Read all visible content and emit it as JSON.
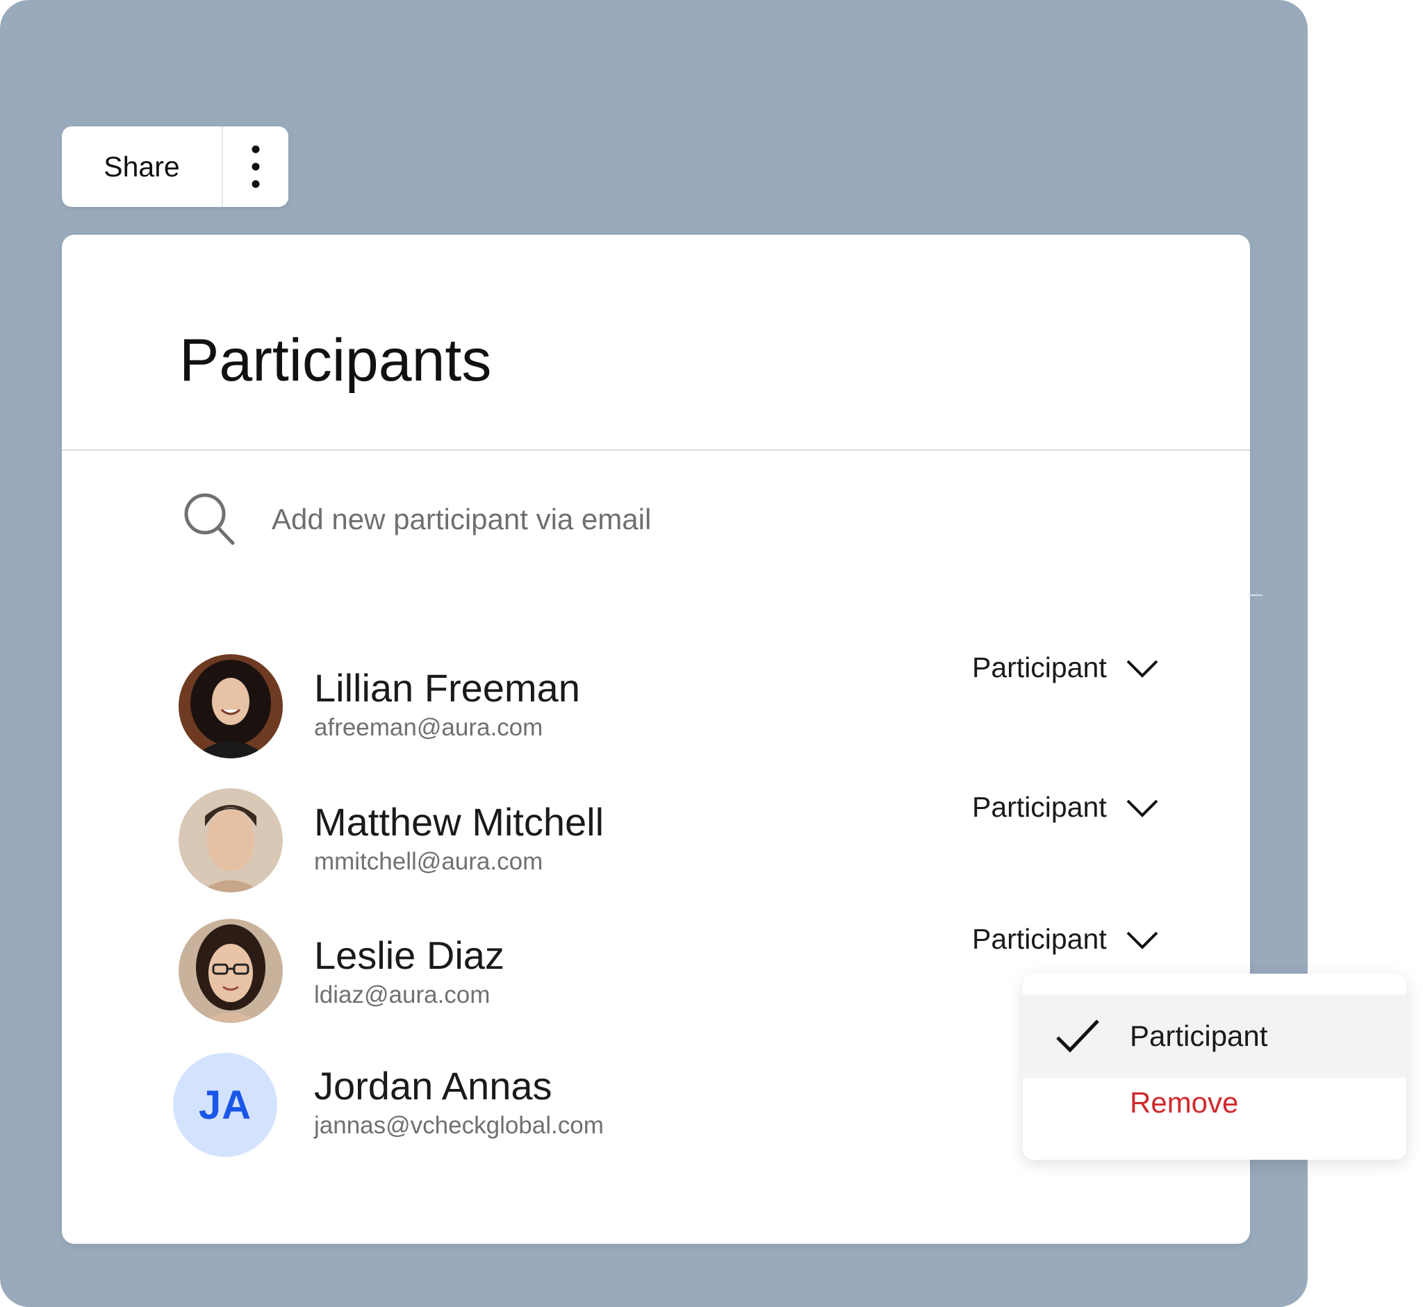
{
  "toolbar": {
    "share_label": "Share",
    "more_icon": "more-vertical-icon"
  },
  "panel": {
    "title": "Participants",
    "search": {
      "placeholder": "Add new participant via email",
      "icon": "search-icon"
    }
  },
  "participants": [
    {
      "name": "Lillian Freeman",
      "email": "afreeman@aura.com",
      "role": "Participant",
      "avatar": "photo"
    },
    {
      "name": "Matthew Mitchell",
      "email": "mmitchell@aura.com",
      "role": "Participant",
      "avatar": "photo"
    },
    {
      "name": "Leslie Diaz",
      "email": "ldiaz@aura.com",
      "role": "Participant",
      "avatar": "photo"
    },
    {
      "name": "Jordan Annas",
      "email": "jannas@vcheckglobal.com",
      "initials": "JA",
      "avatar": "initials"
    }
  ],
  "role_menu": {
    "items": [
      {
        "label": "Participant",
        "selected": true
      },
      {
        "label": "Remove",
        "danger": true
      }
    ]
  },
  "colors": {
    "backdrop": "#98aabb",
    "danger": "#d0292c",
    "initials_bg": "#d4e3fd",
    "initials_text": "#1a56e8"
  }
}
